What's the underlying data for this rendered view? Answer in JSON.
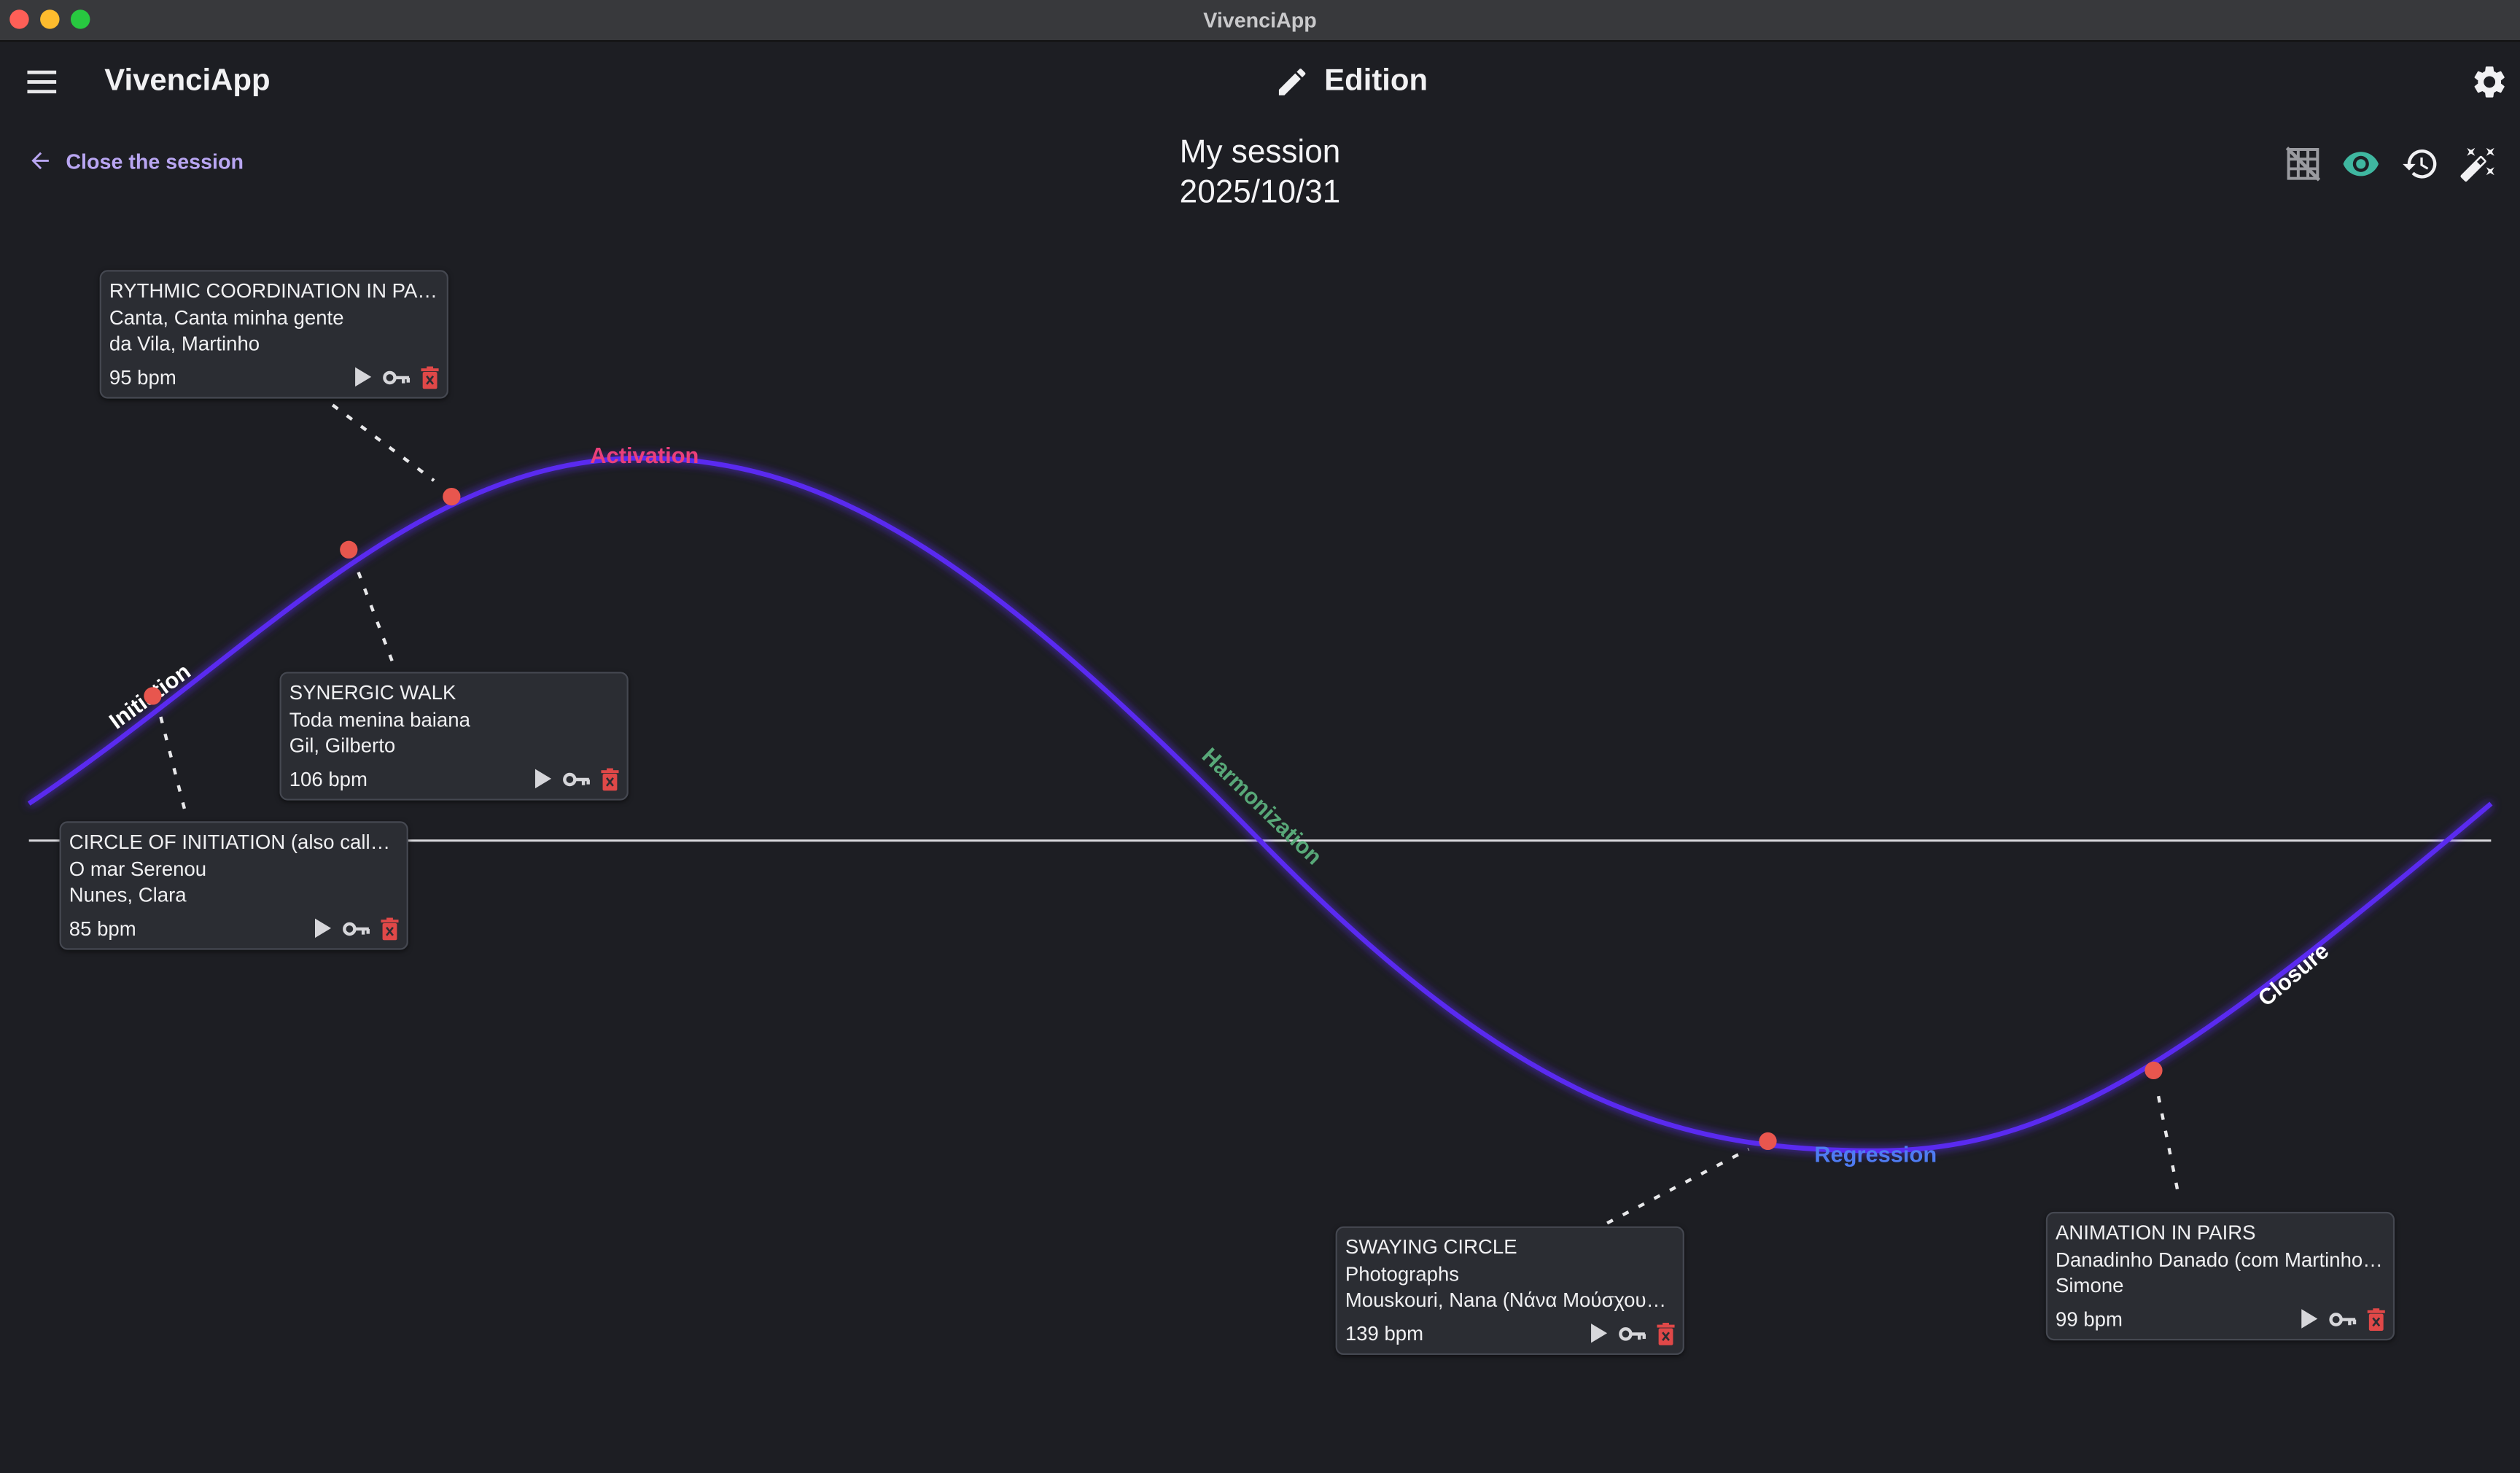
{
  "window": {
    "title": "VivenciApp"
  },
  "header": {
    "app_name": "VivenciApp",
    "mode_label": "Edition",
    "menu_icon": "menu-icon",
    "mode_icon": "pencil-icon",
    "settings_icon": "gear-icon"
  },
  "session": {
    "close_label": "Close the session",
    "name": "My session",
    "date": "2025/10/31"
  },
  "toolbar": {
    "icons": [
      "grid-off-icon",
      "eye-icon",
      "history-icon",
      "magic-wand-icon"
    ]
  },
  "colors": {
    "background": "#1d1e23",
    "card": "#2b2d33",
    "curve": "#5a2cf0",
    "marker": "#e8564e",
    "accent": "#b9a6f2",
    "eye": "#3fb7a0",
    "delete": "#e04848",
    "activation": "#ea3f7a",
    "harmonization": "#58a878",
    "regression": "#4f7cf2",
    "initiation": "#ffffff",
    "closure": "#ffffff"
  },
  "phases": {
    "initiation": "Initiation",
    "activation": "Activation",
    "harmonization": "Harmonization",
    "regression": "Regression",
    "closure": "Closure"
  },
  "cards": [
    {
      "title": "RYTHMIC COORDINATION IN PAIRS (...",
      "song": "Canta, Canta minha gente",
      "artist": "da Vila, Martinho",
      "bpm": "95 bpm"
    },
    {
      "title": "SYNERGIC WALK",
      "song": "Toda menina baiana",
      "artist": "Gil, Gilberto",
      "bpm": "106 bpm"
    },
    {
      "title": "CIRCLE OF INITIATION (also called \"C...",
      "song": "O mar Serenou",
      "artist": "Nunes, Clara",
      "bpm": "85 bpm"
    },
    {
      "title": "SWAYING CIRCLE",
      "song": "Photographs",
      "artist": "Mouskouri, Nana (Νάνα Μούσχουρη)",
      "bpm": "139 bpm"
    },
    {
      "title": "ANIMATION IN PAIRS",
      "song": "Danadinho Danado (com Martinho d...",
      "artist": "Simone",
      "bpm": "99 bpm"
    }
  ]
}
